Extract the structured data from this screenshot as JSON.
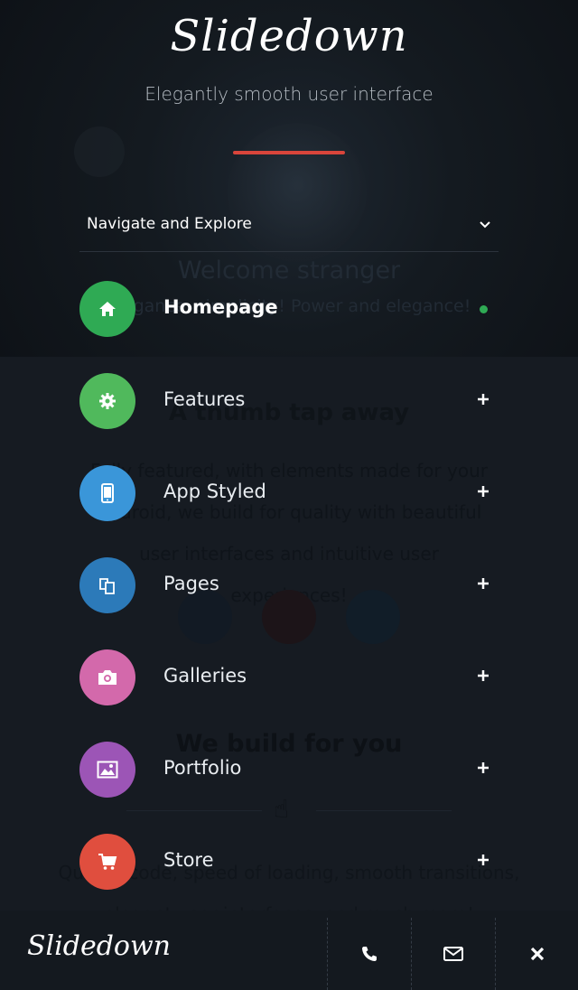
{
  "header": {
    "logo": "Slidedown",
    "subtitle": "Elegantly smooth user interface",
    "accent_color": "#d9453b"
  },
  "background": {
    "welcome": "Welcome stranger",
    "tagline": "Elegance, simplicity! Power and elegance!",
    "thumb_title": "A thumb tap away",
    "paragraph": "Fully featured, with elements made for your Android, we build for quality with beautiful user interfaces and intuitive user experiences!",
    "social": [
      "facebook-icon",
      "google-plus-icon",
      "twitter-icon"
    ],
    "build_title": "We build for you",
    "paragraph2": "Quality code, speed of loading, smooth transitions, elegant user interfaces, and much more!"
  },
  "menu": {
    "heading": "Navigate and Explore",
    "heading_icon": "chevron-down-icon",
    "items": [
      {
        "label": "Homepage",
        "icon": "home-icon",
        "color": "#2faa54",
        "active": true,
        "indicator": "active-dot",
        "indicator_color": "#2faa54"
      },
      {
        "label": "Features",
        "icon": "gear-icon",
        "color": "#50b95c",
        "active": false,
        "indicator": "plus-icon"
      },
      {
        "label": "App Styled",
        "icon": "mobile-icon",
        "color": "#3a96d9",
        "active": false,
        "indicator": "plus-icon"
      },
      {
        "label": "Pages",
        "icon": "pages-icon",
        "color": "#2c7ab9",
        "active": false,
        "indicator": "plus-icon"
      },
      {
        "label": "Galleries",
        "icon": "camera-icon",
        "color": "#d369ab",
        "active": false,
        "indicator": "plus-icon"
      },
      {
        "label": "Portfolio",
        "icon": "image-icon",
        "color": "#9c55b6",
        "active": false,
        "indicator": "plus-icon"
      },
      {
        "label": "Store",
        "icon": "cart-icon",
        "color": "#e04e3e",
        "active": false,
        "indicator": "plus-icon"
      }
    ]
  },
  "footer": {
    "logo": "Slidedown",
    "buttons": [
      "phone-icon",
      "mail-icon",
      "close-icon"
    ]
  }
}
